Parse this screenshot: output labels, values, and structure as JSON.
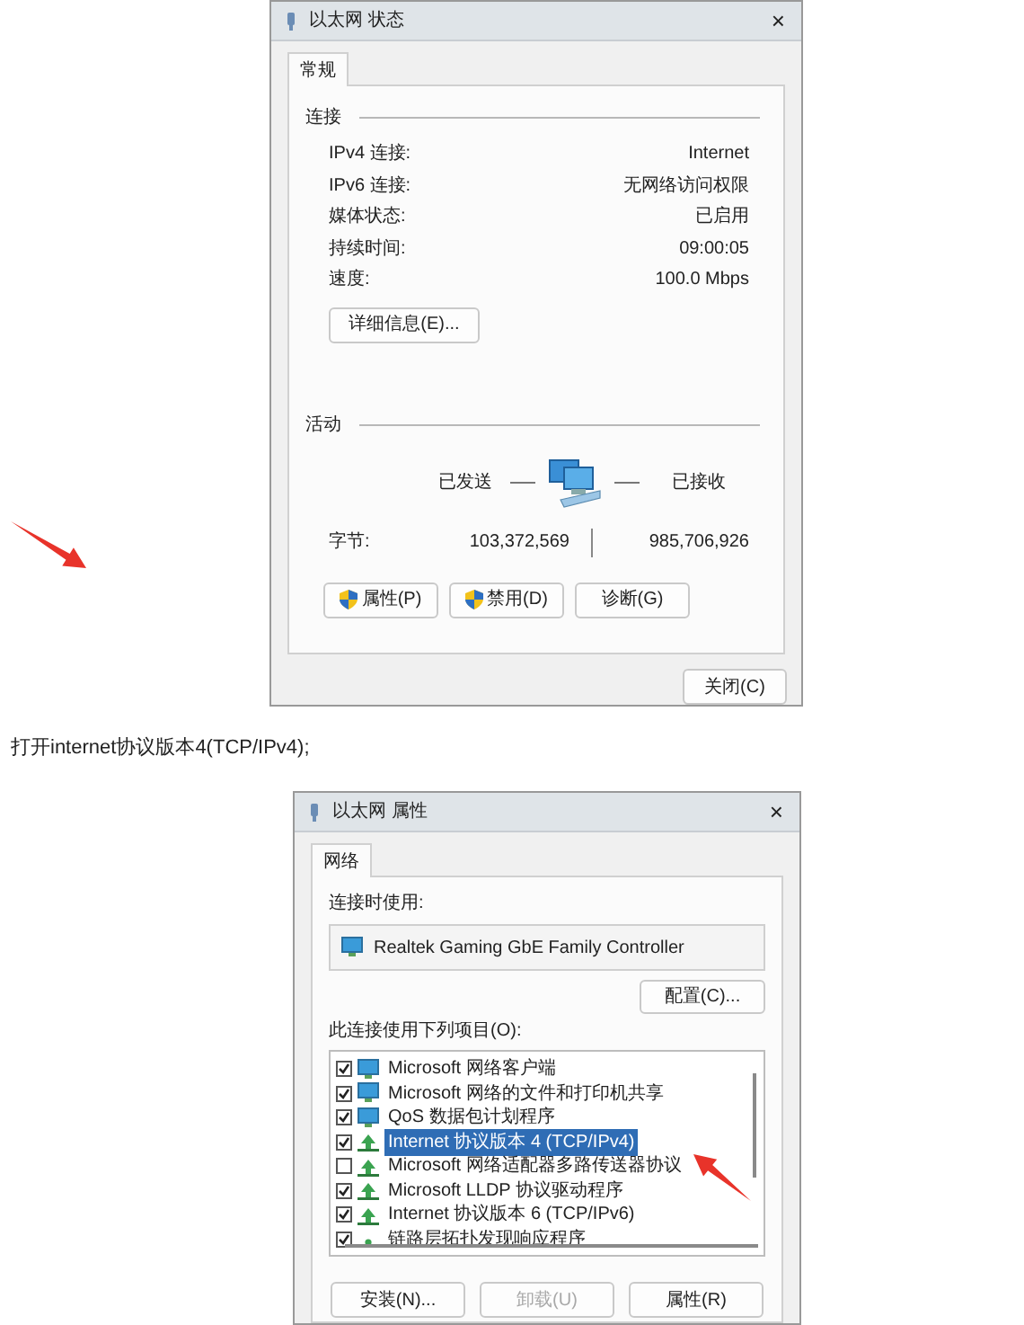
{
  "status_dialog": {
    "title": "以太网 状态",
    "close": "×",
    "tabs": [
      {
        "label": "常规",
        "selected": true
      }
    ],
    "connection_heading": "连接",
    "info_rows": [
      {
        "label": "IPv4 连接:",
        "value": "Internet"
      },
      {
        "label": "IPv6 连接:",
        "value": "无网络访问权限"
      },
      {
        "label": "媒体状态:",
        "value": "已启用"
      },
      {
        "label": "持续时间:",
        "value": "09:00:05"
      },
      {
        "label": "速度:",
        "value": "100.0 Mbps"
      }
    ],
    "details_button": "详细信息(E)...",
    "activity_heading": "活动",
    "sent_label": "已发送",
    "received_label": "已接收",
    "bytes_label": "字节:",
    "bytes_sent": "103,372,569",
    "bytes_received": "985,706,926",
    "buttons": [
      {
        "label": "属性(P)",
        "shield": true
      },
      {
        "label": "禁用(D)",
        "shield": true
      },
      {
        "label": "诊断(G)",
        "shield": false
      }
    ],
    "close_button": "关闭(C)"
  },
  "caption": "打开internet协议版本4(TCP/IPv4);",
  "properties_dialog": {
    "title": "以太网 属性",
    "close": "×",
    "tabs": [
      {
        "label": "网络",
        "selected": true
      }
    ],
    "connect_using_label": "连接时使用:",
    "adapter": "Realtek Gaming GbE Family Controller",
    "configure_button": "配置(C)...",
    "items_label": "此连接使用下列项目(O):",
    "items": [
      {
        "label": "Microsoft 网络客户端",
        "checked": true,
        "selected": false,
        "kind": "client"
      },
      {
        "label": "Microsoft 网络的文件和打印机共享",
        "checked": true,
        "selected": false,
        "kind": "client"
      },
      {
        "label": "QoS 数据包计划程序",
        "checked": true,
        "selected": false,
        "kind": "client"
      },
      {
        "label": "Internet 协议版本 4 (TCP/IPv4)",
        "checked": true,
        "selected": true,
        "kind": "protocol"
      },
      {
        "label": "Microsoft 网络适配器多路传送器协议",
        "checked": false,
        "selected": false,
        "kind": "protocol"
      },
      {
        "label": "Microsoft LLDP 协议驱动程序",
        "checked": true,
        "selected": false,
        "kind": "protocol"
      },
      {
        "label": "Internet 协议版本 6 (TCP/IPv6)",
        "checked": true,
        "selected": false,
        "kind": "protocol"
      },
      {
        "label": "链路层拓扑发现响应程序",
        "checked": true,
        "selected": false,
        "kind": "responder"
      }
    ],
    "buttons": [
      {
        "label": "安装(N)...",
        "disabled": false
      },
      {
        "label": "卸载(U)",
        "disabled": true
      },
      {
        "label": "属性(R)",
        "disabled": false
      }
    ]
  }
}
